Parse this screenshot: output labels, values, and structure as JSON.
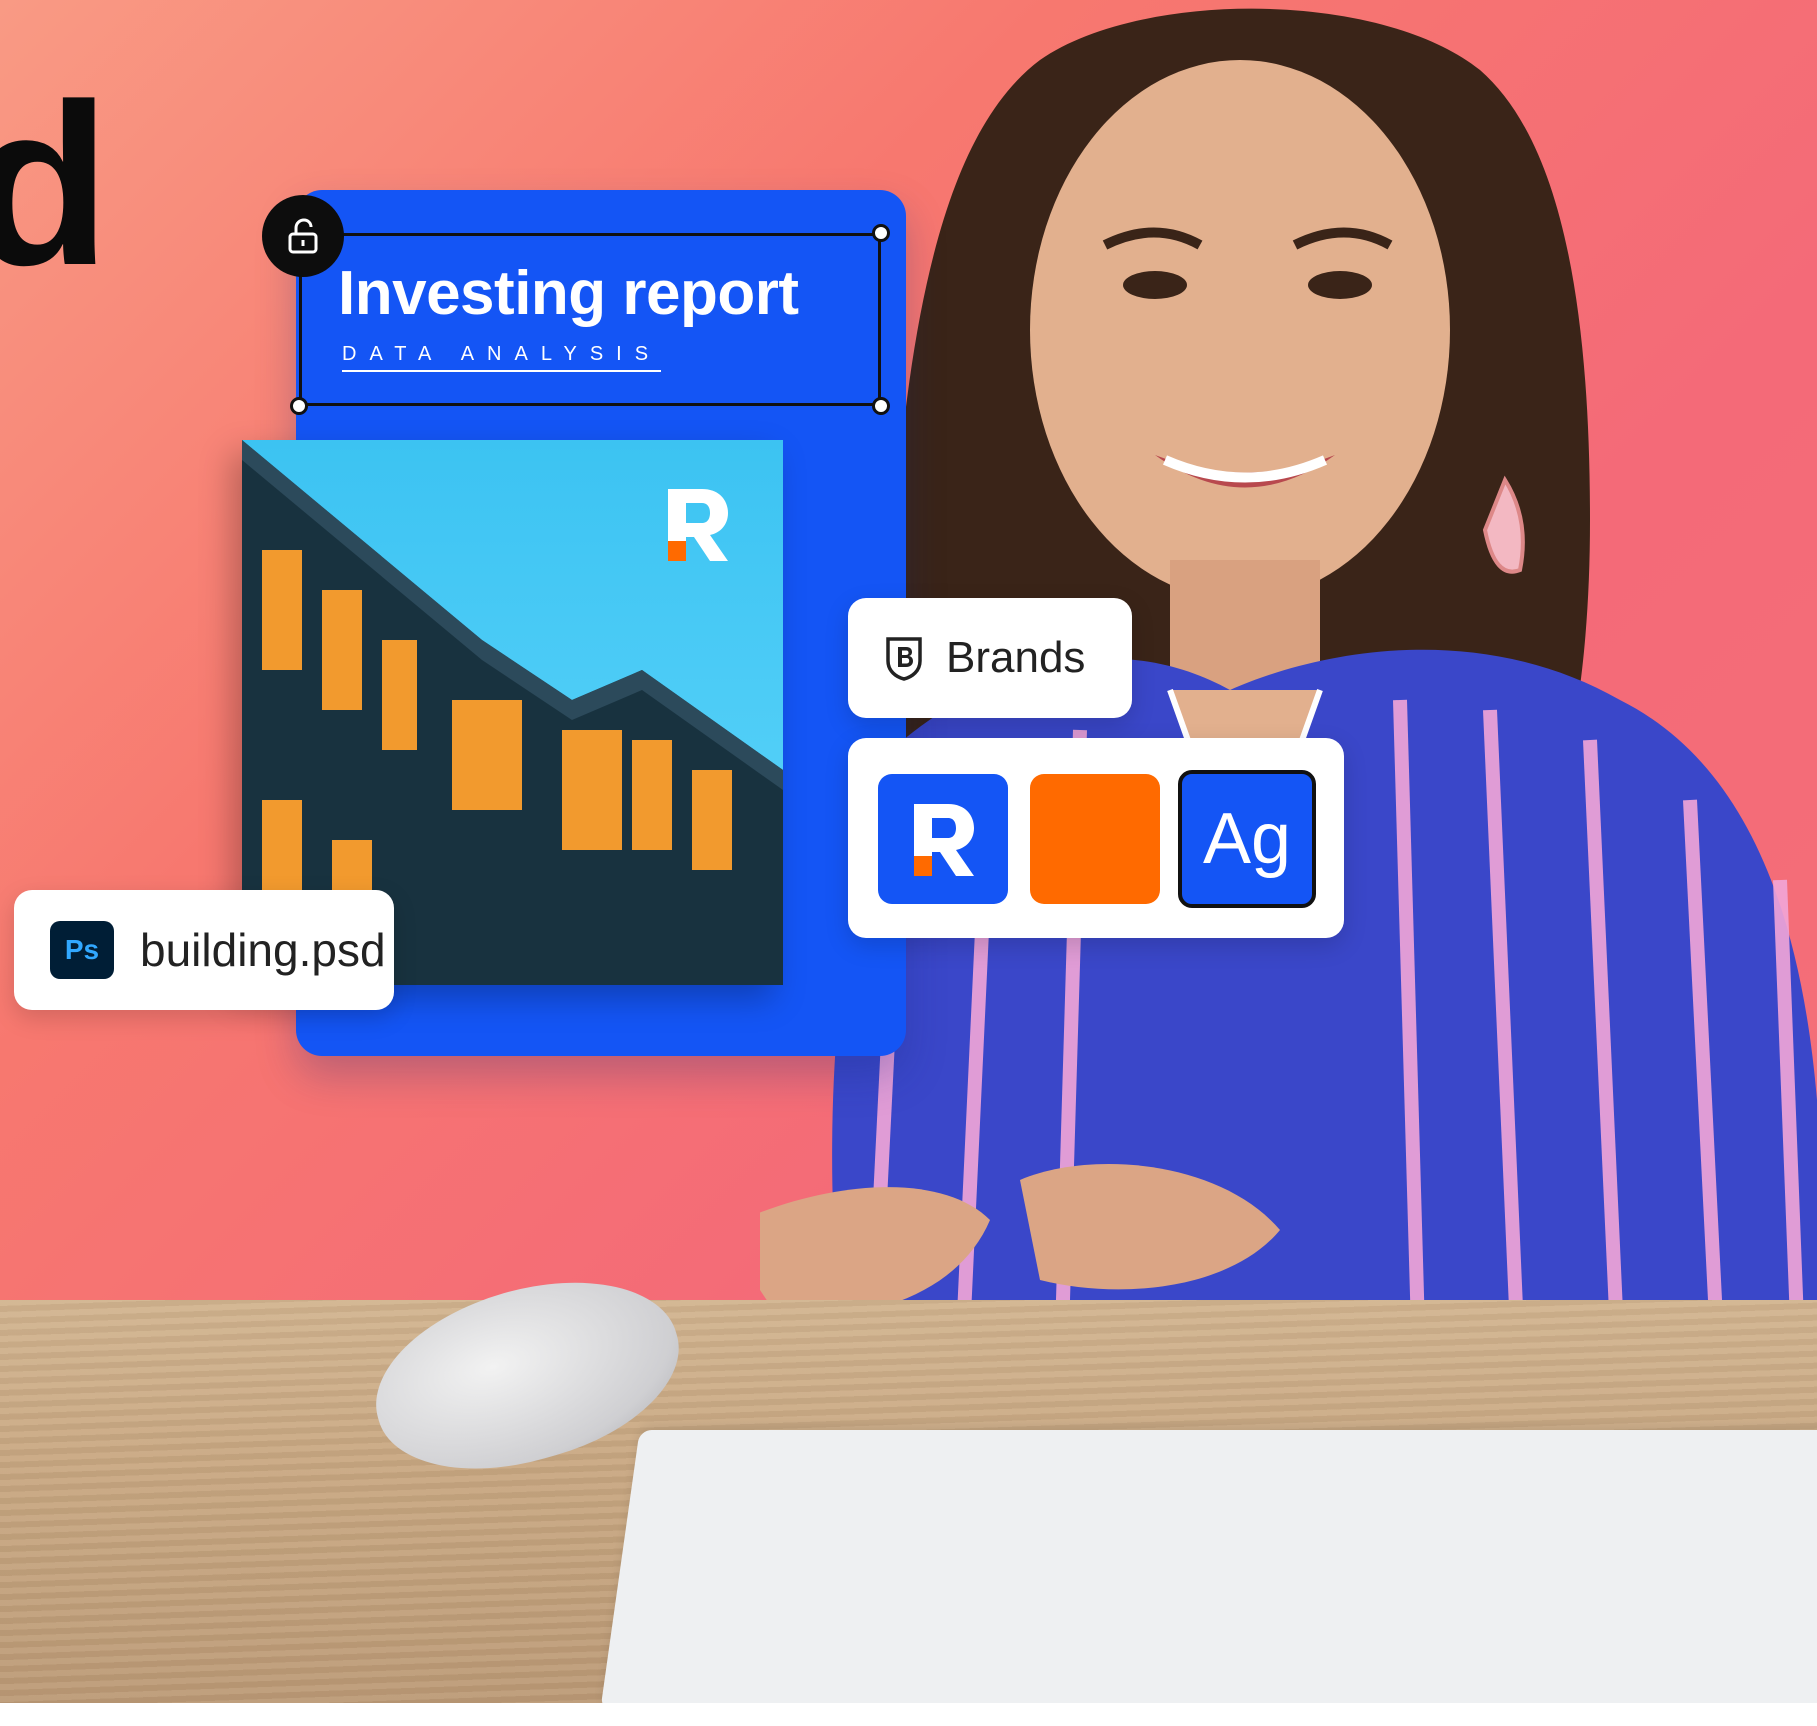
{
  "hero": {
    "letter": "d"
  },
  "report_card": {
    "title": "Investing report",
    "subtitle": "DATA ANALYSIS",
    "lock_icon": "lock-open-icon",
    "logo_letter": "R"
  },
  "file_chip": {
    "app_badge": "Ps",
    "filename": "building.psd",
    "icon": "photoshop-icon"
  },
  "brands_chip": {
    "label": "Brands",
    "icon": "brand-shield-icon"
  },
  "swatches": {
    "logo_letter": "R",
    "font_sample": "Ag",
    "colors": {
      "brand_blue": "#1455f5",
      "brand_orange": "#ff6a00"
    }
  }
}
